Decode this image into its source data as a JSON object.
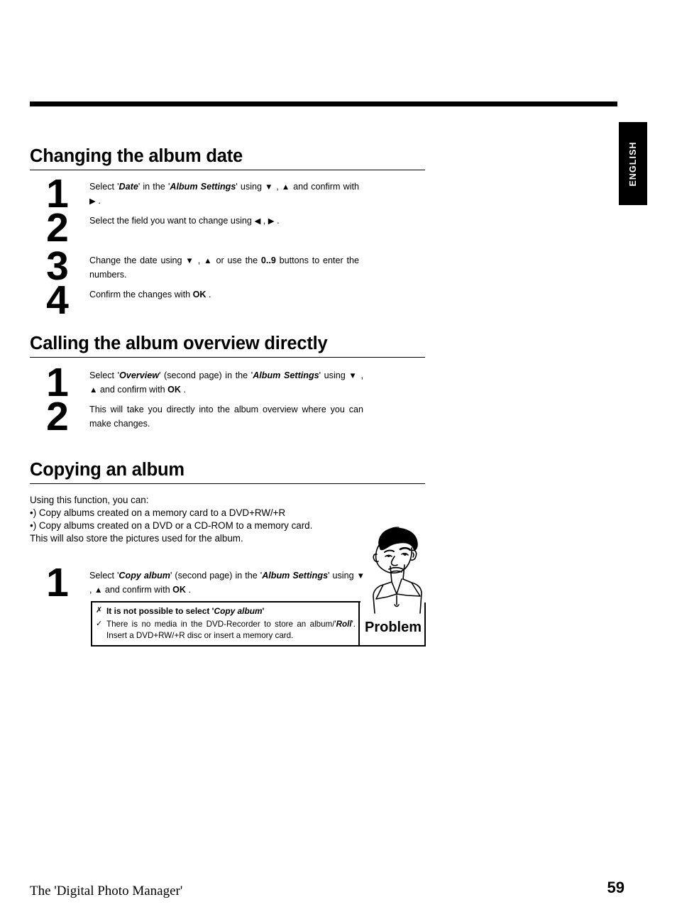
{
  "language_tab": "ENGLISH",
  "sections": [
    {
      "heading": "Changing the album date",
      "steps": [
        {
          "number": "1",
          "text_html": "Select '<b><i>Date</i></b>' in the '<b><i>Album Settings</i></b>' using <span class=\"tri\">▼</span> , <span class=\"tri\">▲</span> and confirm with <span class=\"tri\">▶</span> ."
        },
        {
          "number": "2",
          "text_html": "Select the field you want to change using <span class=\"tri\">◀</span> , <span class=\"tri\">▶</span> ."
        },
        {
          "number": "3",
          "text_html": "Change the date using <span class=\"tri\">▼</span> , <span class=\"tri\">▲</span> or use the <b>0..9</b> buttons to enter the numbers."
        },
        {
          "number": "4",
          "text_html": "Confirm the changes with <b>OK</b> ."
        }
      ]
    },
    {
      "heading": "Calling the album overview directly",
      "steps": [
        {
          "number": "1",
          "text_html": "Select '<b><i>Overview</i></b>' (second page) in the '<b><i>Album Settings</i></b>' using <span class=\"tri\">▼</span> , <span class=\"tri\">▲</span> and confirm with <b>OK</b> ."
        },
        {
          "number": "2",
          "text_html": "This will take you directly into the album overview where you can make changes."
        }
      ]
    },
    {
      "heading": "Copying an album",
      "intro": [
        "Using this function, you can:",
        "•)  Copy albums created on a memory card to a DVD+RW/+R",
        "•)  Copy albums created on a DVD or a CD-ROM to a memory card.",
        "This will also store the pictures used for the album."
      ],
      "steps": [
        {
          "number": "1",
          "text_html": "Select '<b><i>Copy album</i></b>' (second page) in the '<b><i>Album Settings</i></b>' using <span class=\"tri\">▼</span> , <span class=\"tri\">▲</span> and confirm with <b>OK</b> ."
        }
      ]
    }
  ],
  "problem_box": {
    "label": "Problem",
    "cross_mark": "✗",
    "check_mark": "✓",
    "issue_html": "It is not possible to select '<b><i>Copy album</i></b>'",
    "solution_html": "There is no media in the DVD-Recorder to store an album/'<b><i>Roll</i></b>'. Insert a DVD+RW/+R disc or insert a memory card."
  },
  "footer": {
    "title": "The 'Digital Photo Manager'",
    "page_number": "59"
  }
}
